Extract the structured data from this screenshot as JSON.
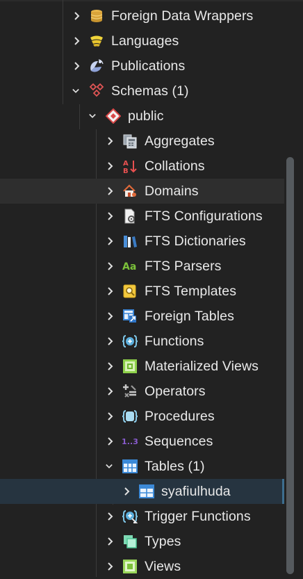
{
  "tree": {
    "items": [
      {
        "label": "Foreign Data Wrappers",
        "icon": "foreign-data-wrapper-icon",
        "expanded": false
      },
      {
        "label": "Languages",
        "icon": "languages-icon",
        "expanded": false
      },
      {
        "label": "Publications",
        "icon": "publications-icon",
        "expanded": false
      },
      {
        "label": "Schemas (1)",
        "icon": "schemas-icon",
        "expanded": true
      },
      {
        "label": "public",
        "icon": "schema-public-icon",
        "expanded": true
      },
      {
        "label": "Aggregates",
        "icon": "aggregates-icon",
        "expanded": false
      },
      {
        "label": "Collations",
        "icon": "collations-icon",
        "expanded": false
      },
      {
        "label": "Domains",
        "icon": "domains-icon",
        "expanded": false
      },
      {
        "label": "FTS Configurations",
        "icon": "fts-configurations-icon",
        "expanded": false
      },
      {
        "label": "FTS Dictionaries",
        "icon": "fts-dictionaries-icon",
        "expanded": false
      },
      {
        "label": "FTS Parsers",
        "icon": "fts-parsers-icon",
        "expanded": false
      },
      {
        "label": "FTS Templates",
        "icon": "fts-templates-icon",
        "expanded": false
      },
      {
        "label": "Foreign Tables",
        "icon": "foreign-tables-icon",
        "expanded": false
      },
      {
        "label": "Functions",
        "icon": "functions-icon",
        "expanded": false
      },
      {
        "label": "Materialized Views",
        "icon": "materialized-views-icon",
        "expanded": false
      },
      {
        "label": "Operators",
        "icon": "operators-icon",
        "expanded": false
      },
      {
        "label": "Procedures",
        "icon": "procedures-icon",
        "expanded": false
      },
      {
        "label": "Sequences",
        "icon": "sequences-icon",
        "expanded": false
      },
      {
        "label": "Tables (1)",
        "icon": "tables-icon",
        "expanded": true
      },
      {
        "label": "syafiulhuda",
        "icon": "table-icon",
        "expanded": false
      },
      {
        "label": "Trigger Functions",
        "icon": "trigger-functions-icon",
        "expanded": false
      },
      {
        "label": "Types",
        "icon": "types-icon",
        "expanded": false
      },
      {
        "label": "Views",
        "icon": "views-icon",
        "expanded": false
      }
    ],
    "icon_text": {
      "fts_parsers": "Aa",
      "sequences": "1..3",
      "collations_a": "A",
      "collations_b": "B"
    }
  },
  "colors": {
    "background": "#222222",
    "hover_row": "#2e2e2e",
    "selected_row": "#263440",
    "selected_border": "#3d6e8f",
    "text": "#e9e9e9",
    "scrollbar": "#555a5e"
  }
}
